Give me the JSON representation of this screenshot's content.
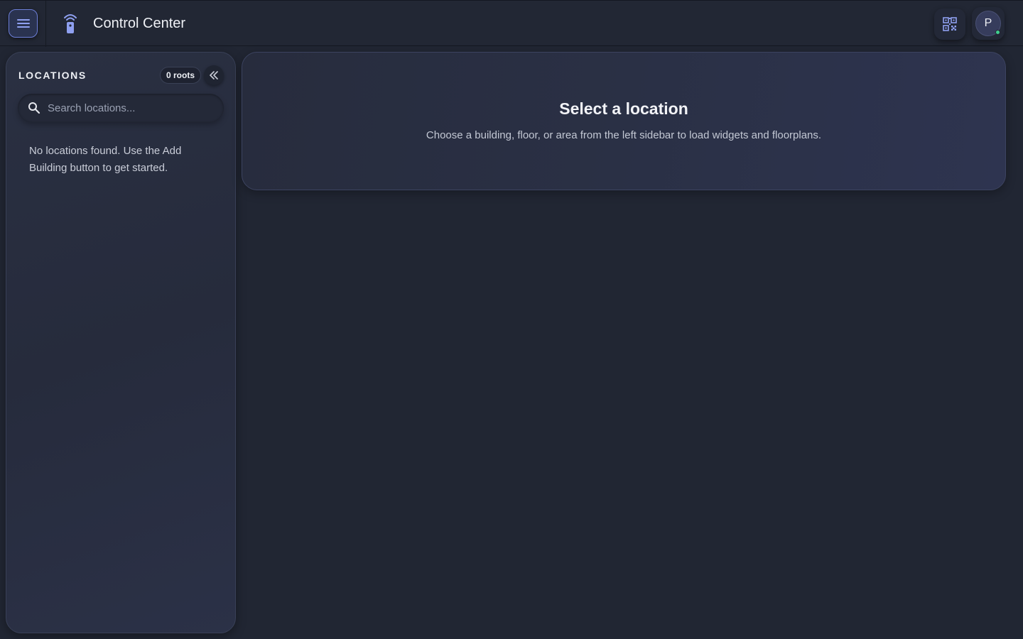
{
  "header": {
    "title": "Control Center",
    "menu_icon": "hamburger-menu-icon",
    "app_icon": "remote-signal-icon",
    "qr_icon": "qr-code-icon",
    "avatar_initial": "P",
    "status_color": "#3fcf8e",
    "accent_color": "#6d7fd8"
  },
  "sidebar": {
    "heading": "LOCATIONS",
    "roots_badge": "0 roots",
    "collapse_icon": "double-chevron-left-icon",
    "search": {
      "placeholder": "Search locations...",
      "value": ""
    },
    "empty_message": "No locations found. Use the Add Building button to get started."
  },
  "main": {
    "title": "Select a location",
    "subtitle": "Choose a building, floor, or area from the left sidebar to load widgets and floorplans."
  }
}
